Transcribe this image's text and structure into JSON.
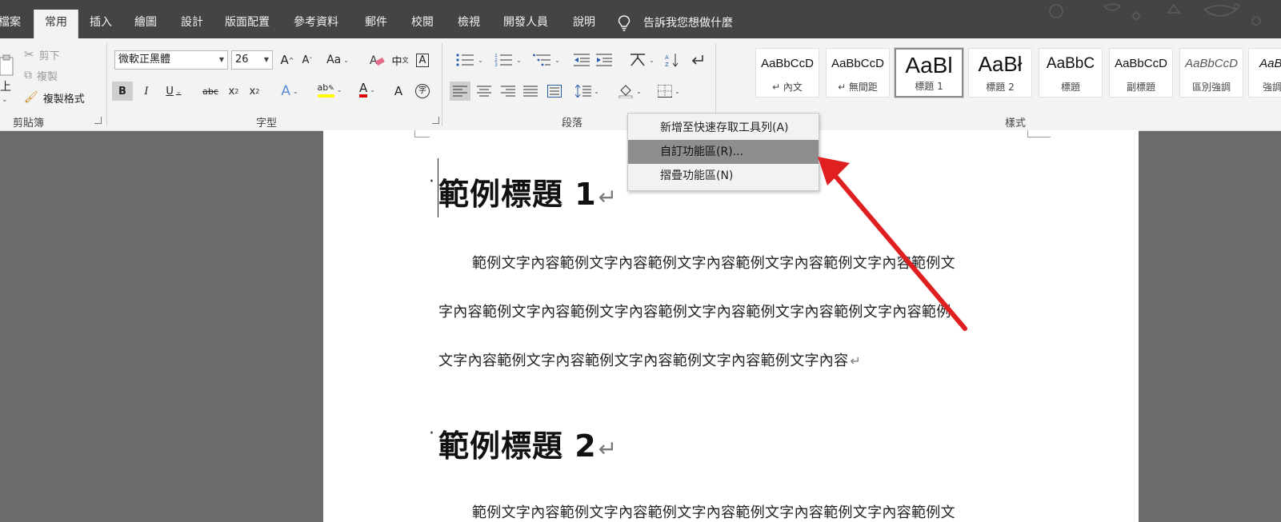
{
  "tabs": [
    {
      "label": "檔案",
      "active": false
    },
    {
      "label": "常用",
      "active": true
    },
    {
      "label": "插入",
      "active": false
    },
    {
      "label": "繪圖",
      "active": false
    },
    {
      "label": "設計",
      "active": false
    },
    {
      "label": "版面配置",
      "active": false
    },
    {
      "label": "參考資料",
      "active": false
    },
    {
      "label": "郵件",
      "active": false
    },
    {
      "label": "校閱",
      "active": false
    },
    {
      "label": "檢視",
      "active": false
    },
    {
      "label": "開發人員",
      "active": false
    },
    {
      "label": "說明",
      "active": false
    }
  ],
  "tell_me": "告訴我您想做什麼",
  "clipboard": {
    "paste_label": "上",
    "cut_label": "剪下",
    "copy_label": "複製",
    "format_painter_label": "複製格式",
    "group_label": "剪貼簿"
  },
  "font": {
    "name": "微軟正黑體",
    "size": "26",
    "group_label": "字型"
  },
  "paragraph": {
    "group_label": "段落"
  },
  "styles": {
    "group_label": "樣式",
    "items": [
      {
        "sample": "AaBbCcD",
        "name": "↵ 內文"
      },
      {
        "sample": "AaBbCcD",
        "name": "↵ 無間距"
      },
      {
        "sample": "AaBl",
        "name": "標題 1",
        "selected": true
      },
      {
        "sample": "AaBł",
        "name": "標題 2"
      },
      {
        "sample": "AaBbC",
        "name": "標題"
      },
      {
        "sample": "AaBbCcD",
        "name": "副標題"
      },
      {
        "sample": "AaBbCcD",
        "name": "區別強調"
      },
      {
        "sample": "AaBl",
        "name": "強調"
      }
    ]
  },
  "context_menu": {
    "items": [
      {
        "label": "新增至快速存取工具列(A)"
      },
      {
        "label": "自訂功能區(R)..."
      },
      {
        "label": "摺疊功能區(N)"
      }
    ]
  },
  "document": {
    "heading1": "範例標題 1",
    "heading2": "範例標題 2",
    "para_lines": [
      "範例文字內容範例文字內容範例文字內容範例文字內容範例文字內容範例文",
      "字內容範例文字內容範例文字內容範例文字內容範例文字內容範例文字內容範例",
      "文字內容範例文字內容範例文字內容範例文字內容範例文字內容"
    ],
    "para2_first_line": "範例文字內容範例文字內容範例文字內容範例文字內容範例文字內容範例文",
    "return_mark": "↵"
  },
  "colors": {
    "tabbar": "#444444",
    "ribbon": "#f3f3f3",
    "canvas": "#6b6b6b",
    "menu_hover": "#8e8e8e",
    "arrow": "#e02020",
    "font_color_bar": "#e00000",
    "highlight_bar": "#ffff00"
  }
}
